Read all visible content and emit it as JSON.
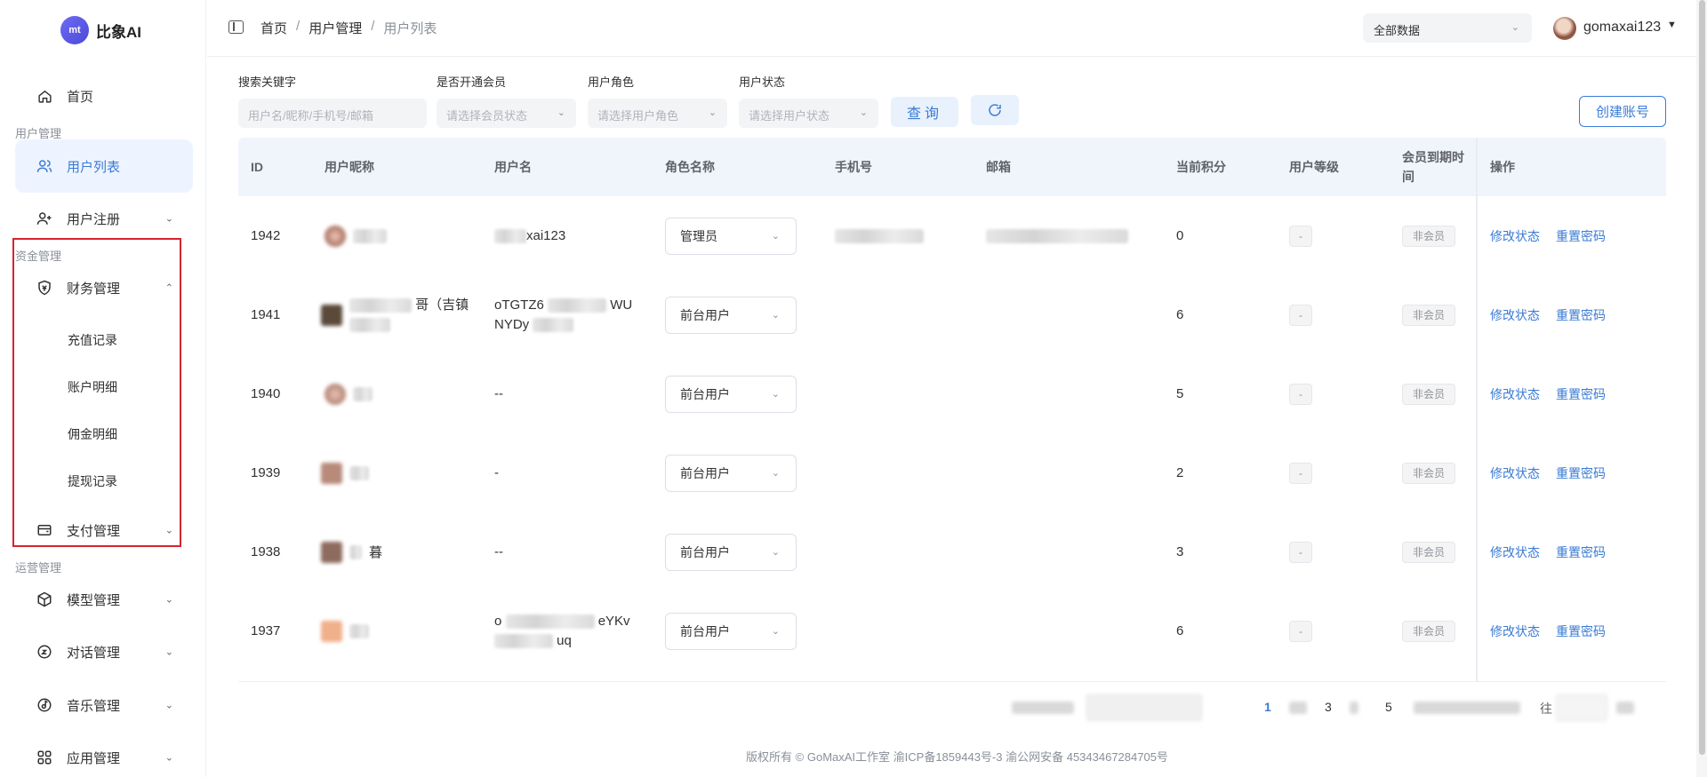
{
  "brand": {
    "logo_glyph": "mt",
    "name": "比象AI"
  },
  "sidebar": {
    "home": "首页",
    "groups": {
      "user": "用户管理",
      "fund": "资金管理",
      "ops": "运营管理"
    },
    "items": [
      {
        "label": "用户列表",
        "icon": "users-icon",
        "active": true
      },
      {
        "label": "用户注册",
        "icon": "user-add-icon"
      },
      {
        "label": "财务管理",
        "icon": "finance-icon",
        "expanded": true
      },
      {
        "label": "支付管理",
        "icon": "wallet-icon"
      },
      {
        "label": "模型管理",
        "icon": "cube-icon"
      },
      {
        "label": "对话管理",
        "icon": "chat-icon"
      },
      {
        "label": "音乐管理",
        "icon": "music-icon"
      },
      {
        "label": "应用管理",
        "icon": "apps-icon"
      }
    ],
    "finance_sub": [
      "充值记录",
      "账户明细",
      "佣金明细",
      "提现记录"
    ]
  },
  "header": {
    "breadcrumb": [
      "首页",
      "用户管理",
      "用户列表"
    ],
    "scope": "全部数据",
    "username": "gomaxai123"
  },
  "filters": {
    "keyword": {
      "label": "搜索关键字",
      "placeholder": "用户名/昵称/手机号/邮箱"
    },
    "member": {
      "label": "是否开通会员",
      "placeholder": "请选择会员状态"
    },
    "role": {
      "label": "用户角色",
      "placeholder": "请选择用户角色"
    },
    "status": {
      "label": "用户状态",
      "placeholder": "请选择用户状态"
    },
    "query_btn": "查询",
    "create_btn": "创建账号"
  },
  "table": {
    "columns": [
      "ID",
      "用户昵称",
      "用户名",
      "角色名称",
      "手机号",
      "邮箱",
      "当前积分",
      "用户等级",
      "会员到期时间",
      "操作"
    ],
    "rows": [
      {
        "id": "1942",
        "nickname": "",
        "username": "xai123",
        "role": "管理员",
        "points": "0",
        "level": "-",
        "vip": "非会员"
      },
      {
        "id": "1941",
        "nickname": "哥（吉镇",
        "username": "oTGTZ6",
        "username2": "WU",
        "username3": "NYDy",
        "role": "前台用户",
        "points": "6",
        "level": "-",
        "vip": "非会员"
      },
      {
        "id": "1940",
        "nickname": "",
        "username": "--",
        "role": "前台用户",
        "points": "5",
        "level": "-",
        "vip": "非会员"
      },
      {
        "id": "1939",
        "nickname": "",
        "username": "-",
        "role": "前台用户",
        "points": "2",
        "level": "-",
        "vip": "非会员"
      },
      {
        "id": "1938",
        "nickname": "暮",
        "username": "--",
        "role": "前台用户",
        "points": "3",
        "level": "-",
        "vip": "非会员"
      },
      {
        "id": "1937",
        "nickname": "",
        "username": "o",
        "username2": "eYKv",
        "username3": "uq",
        "role": "前台用户",
        "points": "6",
        "level": "-",
        "vip": "非会员"
      }
    ],
    "actions": {
      "edit_status": "修改状态",
      "reset_password": "重置密码"
    }
  },
  "pagination": {
    "pages": [
      "1",
      "3",
      "5"
    ],
    "current": "1",
    "goto_suffix": "往"
  },
  "footer": "版权所有 © GoMaxAI工作室  渝ICP备1859443号-3  渝公网安备 45343467284705号",
  "colors": {
    "primary": "#3a7bd5",
    "highlight_box": "#d6232e",
    "header_bg": "#f0f5fc"
  }
}
